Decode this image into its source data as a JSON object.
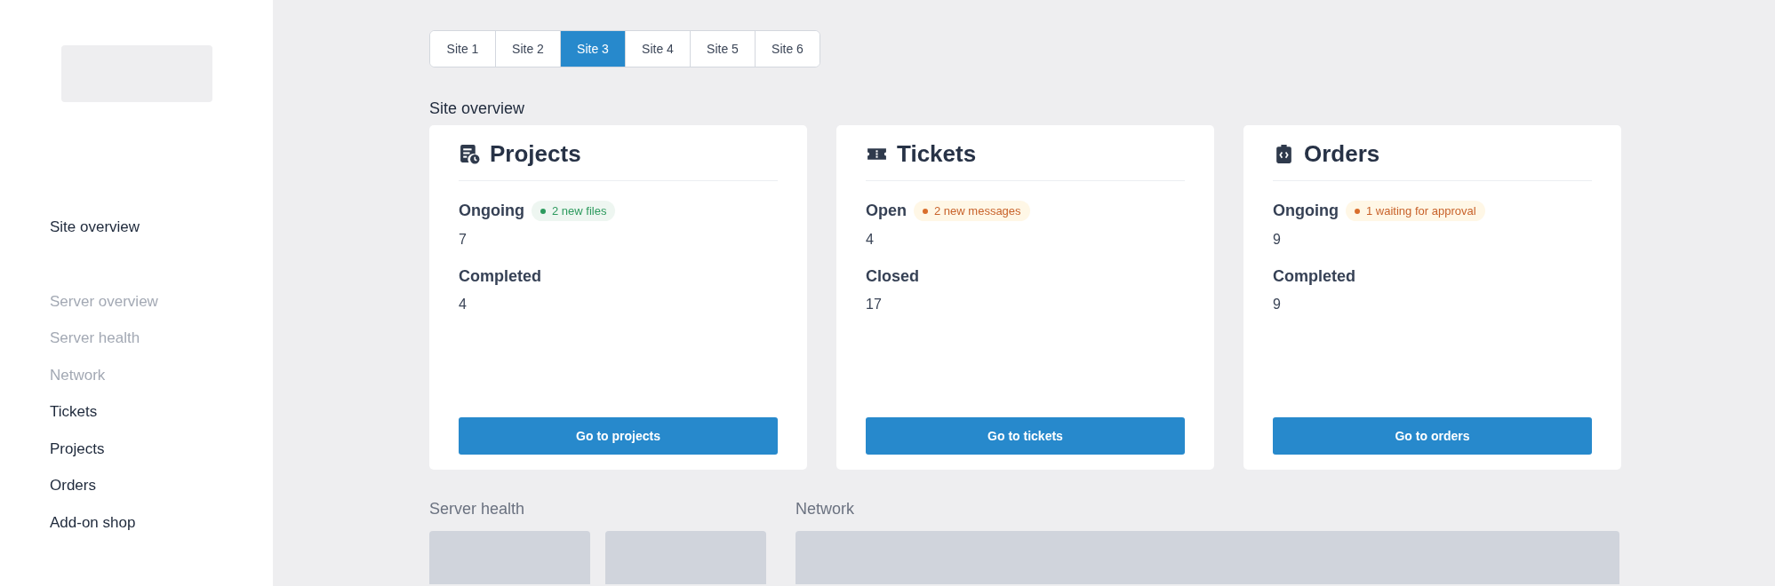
{
  "sidebar": {
    "groups": [
      {
        "items": [
          {
            "label": "Site overview",
            "disabled": false
          }
        ]
      },
      {
        "items": [
          {
            "label": "Server overview",
            "disabled": true
          },
          {
            "label": "Server health",
            "disabled": true
          },
          {
            "label": "Network",
            "disabled": true
          },
          {
            "label": "Tickets",
            "disabled": false
          },
          {
            "label": "Projects",
            "disabled": false
          },
          {
            "label": "Orders",
            "disabled": false
          },
          {
            "label": "Add-on shop",
            "disabled": false
          }
        ]
      }
    ]
  },
  "tabs": [
    {
      "label": "Site 1",
      "selected": false
    },
    {
      "label": "Site 2",
      "selected": false
    },
    {
      "label": "Site 3",
      "selected": true
    },
    {
      "label": "Site 4",
      "selected": false
    },
    {
      "label": "Site 5",
      "selected": false
    },
    {
      "label": "Site 6",
      "selected": false
    }
  ],
  "section_title": "Site overview",
  "cards": [
    {
      "title": "Projects",
      "stats": [
        {
          "label": "Ongoing",
          "value": "7",
          "badge": {
            "text": "2 new files",
            "kind": "success"
          }
        },
        {
          "label": "Completed",
          "value": "4"
        }
      ],
      "button": "Go to projects"
    },
    {
      "title": "Tickets",
      "stats": [
        {
          "label": "Open",
          "value": "4",
          "badge": {
            "text": "2 new messages",
            "kind": "warning"
          }
        },
        {
          "label": "Closed",
          "value": "17"
        }
      ],
      "button": "Go to tickets"
    },
    {
      "title": "Orders",
      "stats": [
        {
          "label": "Ongoing",
          "value": "9",
          "badge": {
            "text": "1 waiting for approval",
            "kind": "warning"
          }
        },
        {
          "label": "Completed",
          "value": "9"
        }
      ],
      "button": "Go to orders"
    }
  ],
  "bottom_sections": [
    {
      "title": "Server health"
    },
    {
      "title": "Network"
    }
  ]
}
